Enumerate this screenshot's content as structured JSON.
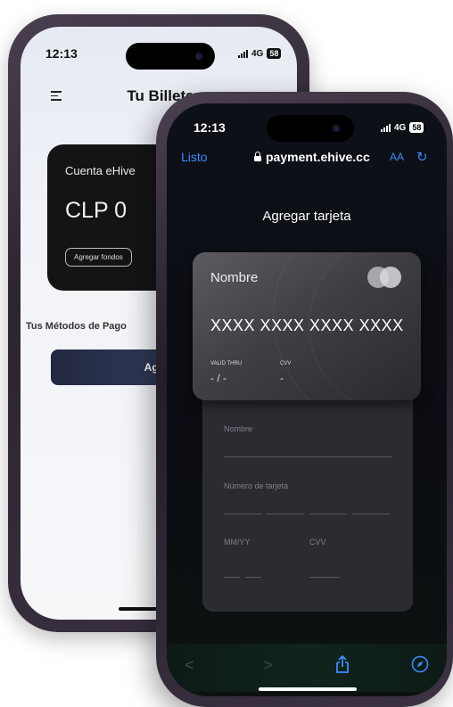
{
  "back_phone": {
    "status_time": "12:13",
    "network": "4G",
    "battery": "58",
    "title": "Tu Billetera",
    "account": {
      "label": "Cuenta eHive",
      "balance": "CLP 0",
      "add_funds": "Agregar fondos"
    },
    "methods_title": "Tus Métodos de Pago",
    "add_method_button": "Agregar mét"
  },
  "front_phone": {
    "status_time": "12:13",
    "network": "4G",
    "battery": "58",
    "browser": {
      "done": "Listo",
      "url": "payment.ehive.cc",
      "text_size": "AA"
    },
    "page_title": "Agregar tarjeta",
    "card_preview": {
      "name": "Nombre",
      "number": "XXXX XXXX XXXX XXXX",
      "valid_thru_label": "VALID THRU",
      "valid_thru_value": "- / -",
      "cvv_label": "CVV",
      "cvv_value": "-"
    },
    "form": {
      "name_label": "Nombre",
      "number_label": "Número de tarjeta",
      "expiry_label": "MM/YY",
      "cvv_label": "CVV"
    },
    "toolbar": {
      "back": "<",
      "forward": ">",
      "share": "share-icon",
      "compass": "compass-icon"
    }
  },
  "colors": {
    "link_blue": "#3b8cff",
    "card_dark": "#141416",
    "button_navy": "#232840"
  }
}
